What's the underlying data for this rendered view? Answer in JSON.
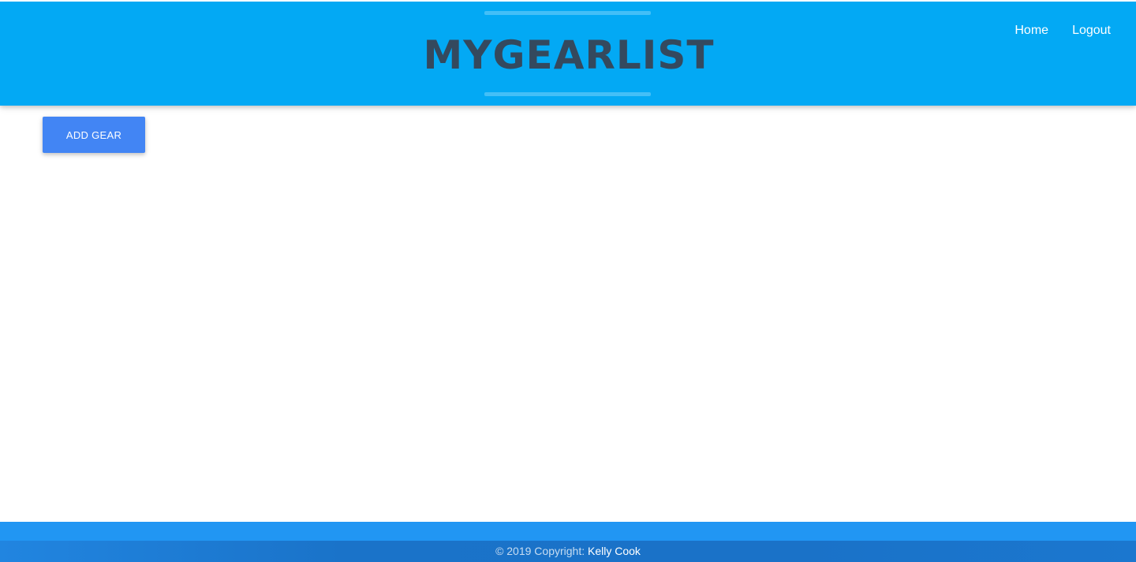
{
  "header": {
    "brand_text": "MYGEARLIST",
    "nav_items": [
      {
        "label": "Home"
      },
      {
        "label": "Logout"
      }
    ],
    "background_color": "#03a9f4",
    "logo_text_color": "#34495e"
  },
  "main": {
    "add_gear_label": "ADD GEAR",
    "button_color": "#4285f4"
  },
  "footer": {
    "copyright_prefix": "© 2019 Copyright: ",
    "author": "Kelly Cook",
    "background_color": "#2196f3"
  }
}
